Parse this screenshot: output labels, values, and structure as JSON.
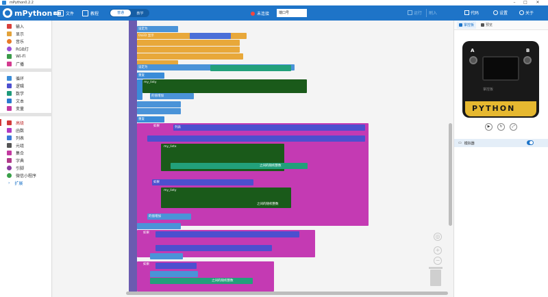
{
  "window": {
    "title": "mPython0.2.2"
  },
  "header": {
    "logo_text": "mPython",
    "logo_badge": "v0.2",
    "file_label": "文件",
    "tutorial_label": "教程",
    "mode_on_label": "普通",
    "mode_off_label": "教学",
    "connection_status": "未连接",
    "port_placeholder": "端口号",
    "run_label": "运行",
    "flash_label": "刷入",
    "code_label": "代码",
    "settings_label": "设置",
    "about_label": "关于",
    "accent_color": "#1e74c8"
  },
  "categories": [
    {
      "label": "输入",
      "color": "#d9403a"
    },
    {
      "label": "显示",
      "color": "#e2a23a"
    },
    {
      "label": "音乐",
      "color": "#e87a27"
    },
    {
      "label": "RGB灯",
      "color": "#9c4ed6"
    },
    {
      "label": "Wi-Fi",
      "color": "#3a9a4a"
    },
    {
      "label": "广播",
      "color": "#d33b8f"
    },
    {
      "label": "循环",
      "color": "#3a8cd8"
    },
    {
      "label": "逻辑",
      "color": "#4d4fcf"
    },
    {
      "label": "数学",
      "color": "#1e9a7a"
    },
    {
      "label": "文本",
      "color": "#2a7ad0"
    },
    {
      "label": "变量",
      "color": "#c23aa0"
    },
    {
      "label": "高级",
      "color": "#d23a3a"
    },
    {
      "label": "函数",
      "color": "#b03ac2"
    },
    {
      "label": "列表",
      "color": "#3a7ad8"
    },
    {
      "label": "元组",
      "color": "#555555"
    },
    {
      "label": "集合",
      "color": "#c23aa0"
    },
    {
      "label": "字典",
      "color": "#b03a8a"
    },
    {
      "label": "引脚",
      "color": "#8a3aa0"
    },
    {
      "label": "微信小程序",
      "color": "#3aa04a"
    },
    {
      "label": "扩展",
      "color": "#1e74c8"
    }
  ],
  "blocks": {
    "oled_text": "OLED 显示",
    "set_label": "设定为",
    "repeat_label": "重复",
    "times_label": "次",
    "do_label": "执行",
    "if_label": "如果",
    "list_label": "列表",
    "var_my_list_x": "my_listx",
    "var_my_list_y": "my_listy",
    "change_label": "的值增加",
    "random_label": "之间的随机整数"
  },
  "right_panel": {
    "tab_board": "掌控板",
    "tab_preview": "预览",
    "board_a": "A",
    "board_b": "B",
    "board_logo": "掌控板",
    "pins_text": "PYTHON",
    "footer_label": "模拟器"
  }
}
